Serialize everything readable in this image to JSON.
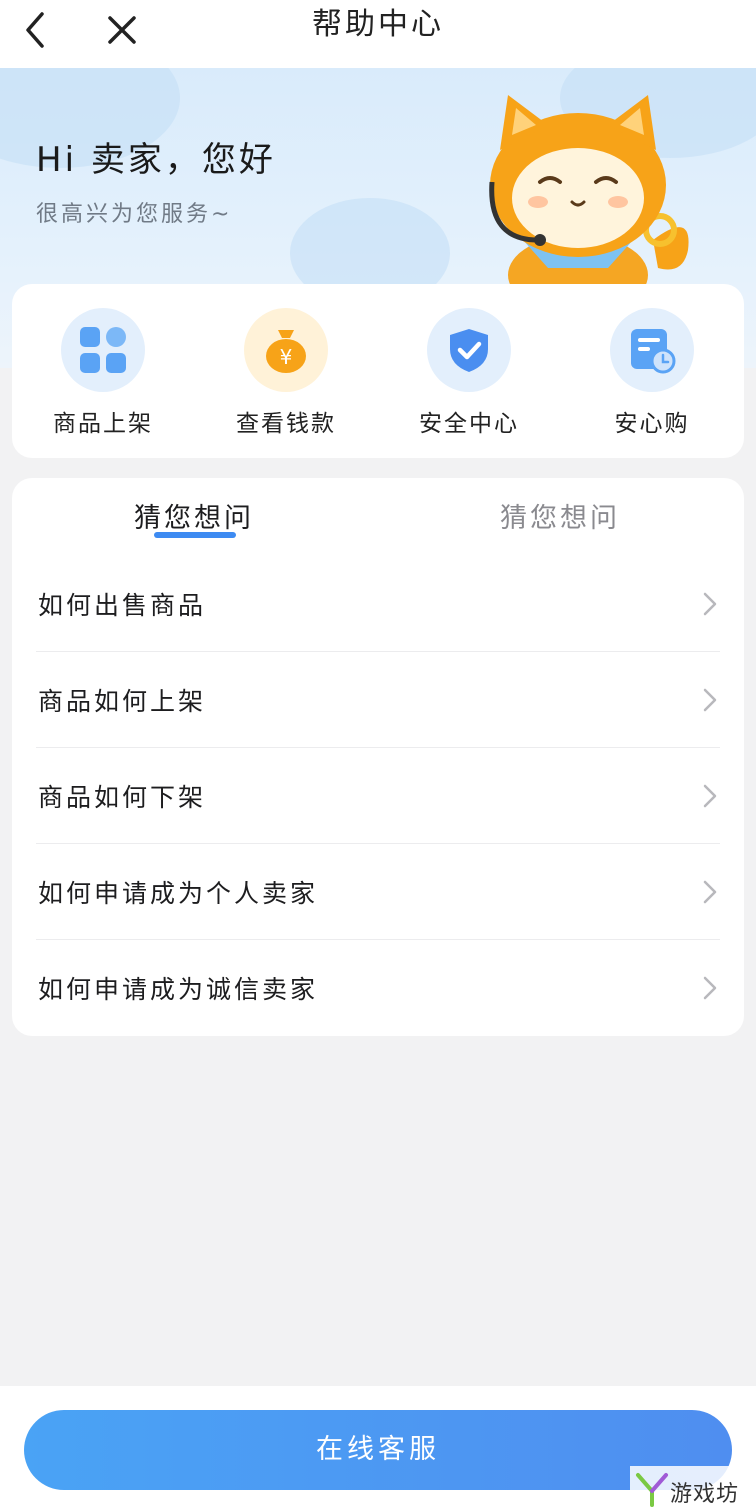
{
  "header": {
    "title": "帮助中心",
    "back_icon": "back-arrow-icon",
    "close_icon": "close-icon"
  },
  "hero": {
    "greeting": "Hi 卖家，您好",
    "subtitle": "很高兴为您服务~",
    "mascot": "cat-mascot"
  },
  "shortcuts": [
    {
      "label": "商品上架",
      "icon": "grid-icon",
      "color": "#5aa3f5"
    },
    {
      "label": "查看钱款",
      "icon": "money-bag-icon",
      "color": "#f7a318"
    },
    {
      "label": "安全中心",
      "icon": "shield-icon",
      "color": "#4a8ef0"
    },
    {
      "label": "安心购",
      "icon": "schedule-icon",
      "color": "#5aa3f5"
    }
  ],
  "faq": {
    "tabs": [
      {
        "label": "猜您想问",
        "active": true
      },
      {
        "label": "猜您想问",
        "active": false
      }
    ],
    "items": [
      {
        "question": "如何出售商品"
      },
      {
        "question": "商品如何上架"
      },
      {
        "question": "商品如何下架"
      },
      {
        "question": "如何申请成为个人卖家"
      },
      {
        "question": "如何申请成为诚信卖家"
      }
    ]
  },
  "footer": {
    "service_label": "在线客服",
    "watermark": "游戏坊"
  },
  "colors": {
    "accent": "#3d8bf2",
    "page_bg": "#f2f2f3",
    "hero_bg": "#dcecfb"
  }
}
